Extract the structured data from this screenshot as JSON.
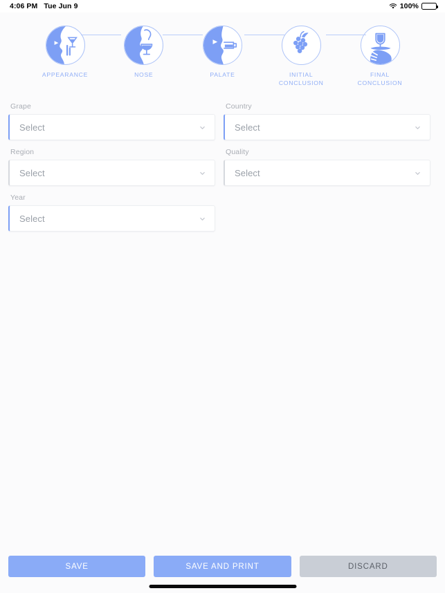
{
  "status_bar": {
    "time": "4:06 PM",
    "date": "Tue Jun 9",
    "battery_percent": "100%",
    "wifi_icon": "wifi-icon",
    "battery_icon": "battery-full-icon"
  },
  "stepper": {
    "steps": [
      {
        "id": "appearance",
        "label": "APPEARANCE",
        "icon": "face-wine-glass-appearance-icon",
        "state": "filled"
      },
      {
        "id": "nose",
        "label": "NOSE",
        "icon": "face-smelling-wine-icon",
        "state": "filled"
      },
      {
        "id": "palate",
        "label": "PALATE",
        "icon": "face-tasting-wine-icon",
        "state": "filled"
      },
      {
        "id": "initial-conclusion",
        "label": "INITIAL\nCONCLUSION",
        "icon": "grapes-icon",
        "state": "outline"
      },
      {
        "id": "final-conclusion",
        "label": "FINAL\nCONCLUSION",
        "icon": "hand-holding-wine-glass-icon",
        "state": "outline"
      }
    ],
    "accent_color": "#90aef6",
    "connector_color": "#b9cdf9"
  },
  "form": {
    "fields": [
      {
        "id": "grape",
        "label": "Grape",
        "value": "Select",
        "accent": true,
        "chevron": "chevron-down-icon"
      },
      {
        "id": "country",
        "label": "Country",
        "value": "Select",
        "accent": true,
        "chevron": "chevron-down-icon"
      },
      {
        "id": "region",
        "label": "Region",
        "value": "Select",
        "accent": false,
        "chevron": "chevron-down-icon"
      },
      {
        "id": "quality",
        "label": "Quality",
        "value": "Select",
        "accent": false,
        "chevron": "chevron-down-icon"
      },
      {
        "id": "year",
        "label": "Year",
        "value": "Select",
        "accent": true,
        "chevron": "chevron-down-icon"
      }
    ]
  },
  "footer": {
    "save_label": "SAVE",
    "save_print_label": "SAVE AND PRINT",
    "discard_label": "DISCARD",
    "primary_color": "#8aabf7",
    "secondary_color": "#c9ced6"
  }
}
